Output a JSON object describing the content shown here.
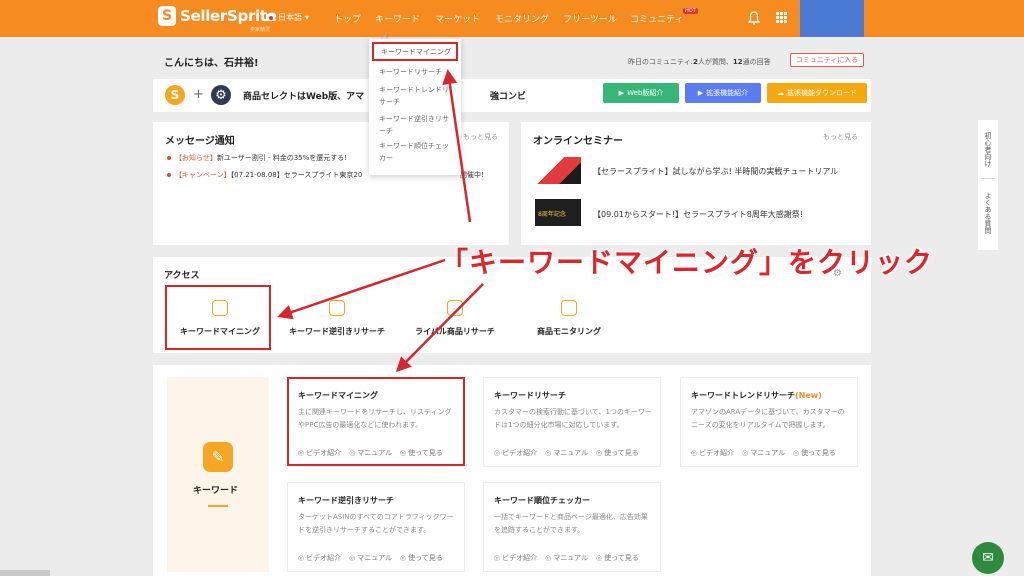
{
  "topbar": {
    "logo_letter": "S",
    "logo_text": "SellerSprite",
    "logo_sub": "卖家精灵",
    "lang": "日本語",
    "nav": [
      "トップ",
      "キーワード",
      "マーケット",
      "モニタリング",
      "フリーツール",
      "コミュニティ"
    ],
    "hot_badge": "HOT"
  },
  "greeting": {
    "text": "こんにちは、石井裕!",
    "stats_prefix": "昨日のコミュニティ:",
    "stats_a": "2",
    "stats_mid": "人が質問、",
    "stats_b": "12",
    "stats_suffix": "通の回答",
    "community_button": "コミュニティに入る"
  },
  "banner": {
    "text": "商品セレクトはWeb版、アマ",
    "text_tail": "強コンビ",
    "buttons": [
      {
        "label": "Web版紹介",
        "color": "#35b77a"
      },
      {
        "label": "拡張機能紹介",
        "color": "#5b7bf2"
      },
      {
        "label": "拡張機能ダウンロード",
        "color": "#f6a80e"
      }
    ]
  },
  "messages": {
    "title": "メッセージ通知",
    "more": "もっと見る",
    "items": [
      {
        "tag": "【お知らせ】",
        "text": "新ユーザー割引 - 料金の35%を還元する!"
      },
      {
        "tag": "【キャンペーン】",
        "text": "【07.21-08.08】セラースプライト東京20",
        "tail": "開催中!"
      }
    ]
  },
  "seminar": {
    "title": "オンラインセミナー",
    "more": "もっと見る",
    "items": [
      {
        "text": "【セラースプライト】試しながら学ぶ! 半時間の実戦チュートリアル"
      },
      {
        "text": "【09.01からスタート!】セラースプライト8周年大感謝祭!",
        "thumb": "8周年記念"
      }
    ]
  },
  "dropdown": {
    "items": [
      "キーワードマイニング",
      "キーワードリサーチ",
      "キーワードトレンドリサーチ",
      "キーワード逆引きリサーチ",
      "キーワード順位チェッカー"
    ]
  },
  "annotation": {
    "callout": "「キーワードマイニング」をクリック"
  },
  "access": {
    "title": "アクセス",
    "items": [
      "キーワードマイニング",
      "キーワード逆引きリサーチ",
      "ライバル商品リサーチ",
      "商品モニタリング"
    ]
  },
  "feature": {
    "category": "キーワード",
    "cards": [
      {
        "title": "キーワードマイニング",
        "new": "",
        "desc": "主に関連キーワードをリサーチし、リスティングやPPC広告の最適化などに使われます。"
      },
      {
        "title": "キーワードリサーチ",
        "new": "",
        "desc": "カスタマーの検索行動に基づいて、1つのキーワードは1つの細分化市場に対応しています。"
      },
      {
        "title": "キーワードトレンドリサーチ",
        "new": "(New)",
        "desc": "アマゾンのARAデータに基づいて、カスタマーのニーズの変化をリアルタイムで把握します。"
      },
      {
        "title": "キーワード逆引きリサーチ",
        "new": "",
        "desc": "ターゲットASINのすべてのコアトラフィックワードを逆引きリサーチすることができます。"
      },
      {
        "title": "キーワード順位チェッカー",
        "new": "",
        "desc": "一括でキーワードと商品ページ最適化、広告効果を追跡することができます。"
      }
    ],
    "foot": [
      "ビデオ紹介",
      "マニュアル",
      "使って見る"
    ]
  },
  "side": {
    "tab1": "初心者向け",
    "tab2": "よくある質問"
  },
  "colors": {
    "brand": "#f68b1f",
    "highlight": "#d6262a"
  }
}
